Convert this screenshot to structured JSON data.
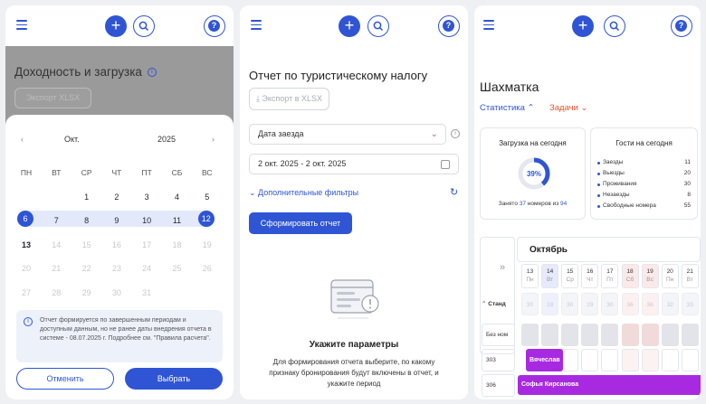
{
  "panel1": {
    "title": "Доходность и загрузка",
    "export_label": "Экспорт XLSX",
    "calendar": {
      "month": "Окт.",
      "year": "2025",
      "weekdays": [
        "ПН",
        "ВТ",
        "СР",
        "ЧТ",
        "ПТ",
        "СБ",
        "ВС"
      ],
      "weeks": [
        [
          "",
          "",
          "1",
          "2",
          "3",
          "4",
          "5"
        ],
        [
          "6",
          "7",
          "8",
          "9",
          "10",
          "11",
          "12"
        ],
        [
          "13",
          "14",
          "15",
          "16",
          "17",
          "18",
          "19"
        ],
        [
          "20",
          "21",
          "22",
          "23",
          "24",
          "25",
          "26"
        ],
        [
          "27",
          "28",
          "29",
          "30",
          "31",
          "",
          ""
        ]
      ]
    },
    "note": "Отчет формируется по завершенным периодам и доступным данным, но не ранее даты внедрения отчета в системе - 08.07.2025 г. Подробнее см. \"Правила расчета\".",
    "cancel_label": "Отменить",
    "ok_label": "Выбрать"
  },
  "panel2": {
    "title": "Отчет по туристическому налогу",
    "export_label": "Экспорт в XLSX",
    "date_type": "Дата заезда",
    "date_range": "2 окт. 2025 - 2 окт. 2025",
    "filters_label": "Дополнительные фильтры",
    "submit_label": "Сформировать отчет",
    "empty_title": "Укажите параметры",
    "empty_text": "Для формирования отчета выберите, по какому признаку бронирования будут включены в отчет, и укажите период"
  },
  "panel3": {
    "title": "Шахматка",
    "tab_stats": "Статистика",
    "tab_tasks": "Задачи",
    "load_title": "Загрузка на сегодня",
    "load_percent": "39%",
    "load_fraction": 0.39,
    "occ_prefix": "Занято",
    "occ_taken": "37",
    "occ_mid": "номеров из",
    "occ_total": "94",
    "guests_title": "Гости на сегодня",
    "guests": [
      {
        "label": "Заезды",
        "value": "11"
      },
      {
        "label": "Выезды",
        "value": "20"
      },
      {
        "label": "Проживания",
        "value": "30"
      },
      {
        "label": "Незаезды",
        "value": "8"
      },
      {
        "label": "Свободные номера",
        "value": "55"
      }
    ],
    "month": "Октябрь",
    "days": [
      {
        "d": "13",
        "w": "Пн"
      },
      {
        "d": "14",
        "w": "Вт"
      },
      {
        "d": "15",
        "w": "Ср"
      },
      {
        "d": "16",
        "w": "Чт"
      },
      {
        "d": "17",
        "w": "Пт"
      },
      {
        "d": "18",
        "w": "Сб"
      },
      {
        "d": "19",
        "w": "Вс"
      },
      {
        "d": "20",
        "w": "Пн"
      },
      {
        "d": "21",
        "w": "Вт"
      }
    ],
    "stand_label": "Станд",
    "stand_values": [
      "30",
      "18",
      "30",
      "29",
      "30",
      "36",
      "36",
      "32",
      "33"
    ],
    "row_noroom": "Без ном",
    "room1": "303",
    "room2": "306",
    "booking1": "Вячеслав",
    "booking2": "Софья Кирсанова"
  },
  "colors": {
    "accent": "#2f55d4",
    "tasks": "#e4572e",
    "booking": "#a82ae0"
  }
}
